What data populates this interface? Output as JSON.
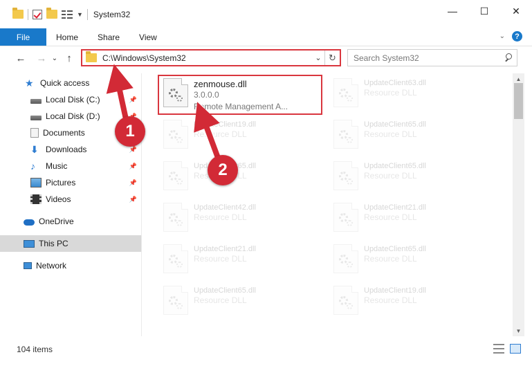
{
  "window": {
    "title": "System32",
    "minimize": "—",
    "maximize": "☐",
    "close": "✕"
  },
  "ribbon": {
    "tabs": [
      "File",
      "Home",
      "Share",
      "View"
    ],
    "expand": "⌄",
    "help": "?"
  },
  "nav": {
    "back": "←",
    "forward": "→",
    "recent": "⌄",
    "up": "↑",
    "address": "C:\\Windows\\System32",
    "refresh": "↻",
    "search_placeholder": "Search System32"
  },
  "sidebar": {
    "items": [
      {
        "label": "Quick access",
        "icon": "star-icon"
      },
      {
        "label": "Local Disk (C:)",
        "icon": "disk-icon",
        "pinned": true
      },
      {
        "label": "Local Disk (D:)",
        "icon": "disk-icon",
        "pinned": true
      },
      {
        "label": "Documents",
        "icon": "documents-icon",
        "pinned": true
      },
      {
        "label": "Downloads",
        "icon": "downloads-icon",
        "pinned": true
      },
      {
        "label": "Music",
        "icon": "music-icon",
        "pinned": true
      },
      {
        "label": "Pictures",
        "icon": "pictures-icon",
        "pinned": true
      },
      {
        "label": "Videos",
        "icon": "videos-icon",
        "pinned": true
      },
      {
        "label": "OneDrive",
        "icon": "onedrive-icon"
      },
      {
        "label": "This PC",
        "icon": "pc-icon",
        "selected": true
      },
      {
        "label": "Network",
        "icon": "network-icon"
      }
    ],
    "pin_glyph": "📌"
  },
  "files": {
    "highlighted": {
      "name": "zenmouse.dll",
      "version": "3.0.0.0",
      "description": "Remote Management A..."
    },
    "left_column": [
      {
        "name": "UpdateClient19.dll",
        "type": "Resource DLL"
      },
      {
        "name": "UpdateClient65.dll",
        "type": "Resource DLL"
      },
      {
        "name": "UpdateClient42.dll",
        "type": "Resource DLL"
      },
      {
        "name": "UpdateClient21.dll",
        "type": "Resource DLL"
      },
      {
        "name": "UpdateClient65.dll",
        "type": "Resource DLL"
      }
    ],
    "right_column": [
      {
        "name": "UpdateClient63.dll",
        "type": "Resource DLL"
      },
      {
        "name": "UpdateClient65.dll",
        "type": "Resource DLL"
      },
      {
        "name": "UpdateClient65.dll",
        "type": "Resource DLL"
      },
      {
        "name": "UpdateClient21.dll",
        "type": "Resource DLL"
      },
      {
        "name": "UpdateClient65.dll",
        "type": "Resource DLL"
      },
      {
        "name": "UpdateClient19.dll",
        "type": "Resource DLL"
      }
    ]
  },
  "status": {
    "item_count": "104 items"
  },
  "callouts": {
    "step1": "1",
    "step2": "2",
    "color": "#d22a36"
  }
}
